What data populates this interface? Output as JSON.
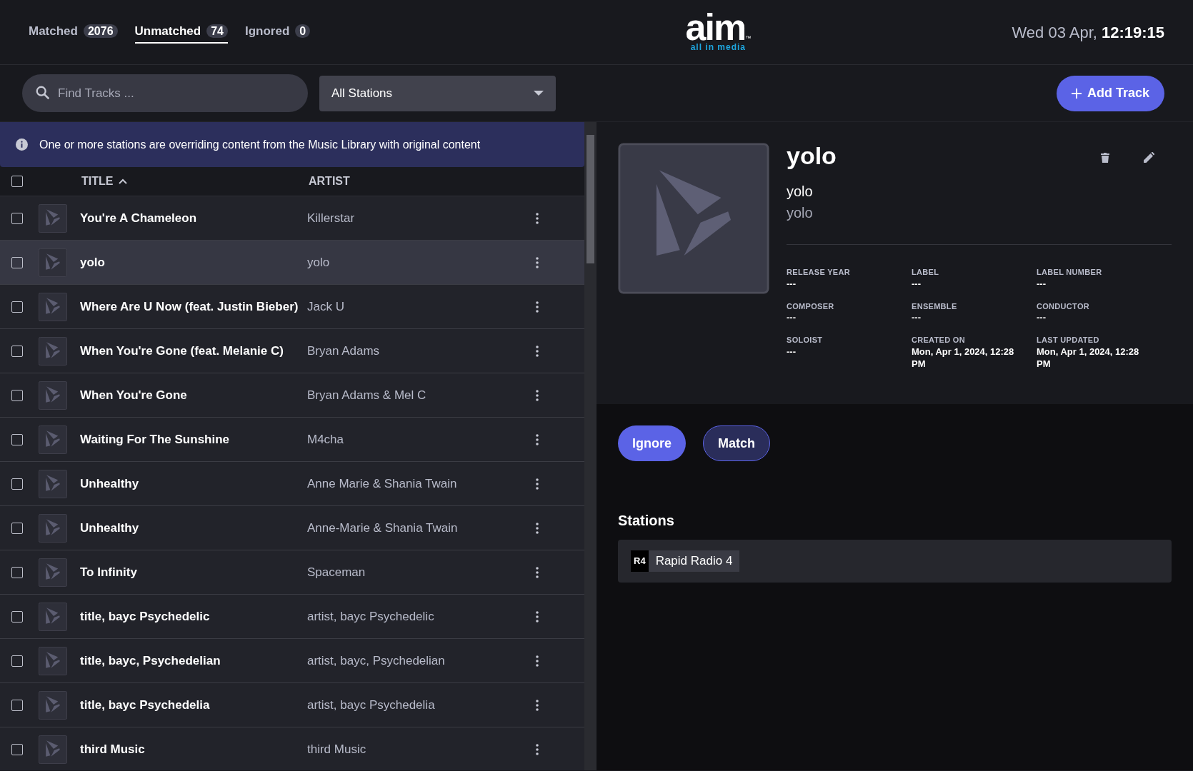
{
  "tabs": [
    {
      "label": "Matched",
      "count": "2076",
      "selected": false
    },
    {
      "label": "Unmatched",
      "count": "74",
      "selected": true
    },
    {
      "label": "Ignored",
      "count": "0",
      "selected": false
    }
  ],
  "logo": {
    "mark": "aim",
    "tm": "™",
    "tagline": "all in media"
  },
  "clock": {
    "date": "Wed 03 Apr,",
    "time": "12:19:15"
  },
  "search": {
    "placeholder": "Find Tracks ..."
  },
  "station_filter": {
    "value": "All Stations"
  },
  "add_button": "Add Track",
  "notice": "One or more stations are overriding content from the Music Library with original content",
  "table": {
    "select_all_checked": false,
    "columns": [
      {
        "label": "TITLE",
        "sorted": true
      },
      {
        "label": "ARTIST",
        "sorted": false
      }
    ],
    "rows": [
      {
        "title": "You're A Chameleon",
        "artist": "Killerstar",
        "checked": false,
        "selected": false
      },
      {
        "title": "yolo",
        "artist": "yolo",
        "checked": false,
        "selected": true
      },
      {
        "title": "Where Are U Now (feat. Justin Bieber)",
        "artist": "Jack U",
        "checked": false,
        "selected": false
      },
      {
        "title": "When You're Gone (feat. Melanie C)",
        "artist": "Bryan Adams",
        "checked": false,
        "selected": false
      },
      {
        "title": "When You're Gone",
        "artist": "Bryan Adams & Mel C",
        "checked": false,
        "selected": false
      },
      {
        "title": "Waiting For The Sunshine",
        "artist": "M4cha",
        "checked": false,
        "selected": false
      },
      {
        "title": "Unhealthy",
        "artist": "Anne Marie & Shania Twain",
        "checked": false,
        "selected": false
      },
      {
        "title": "Unhealthy",
        "artist": "Anne-Marie & Shania Twain",
        "checked": false,
        "selected": false
      },
      {
        "title": "To Infinity",
        "artist": "Spaceman",
        "checked": false,
        "selected": false
      },
      {
        "title": "title, bayc Psychedelic",
        "artist": "artist, bayc Psychedelic",
        "checked": false,
        "selected": false
      },
      {
        "title": "title, bayc, Psychedelian",
        "artist": "artist, bayc, Psychedelian",
        "checked": false,
        "selected": false
      },
      {
        "title": "title, bayc Psychedelia",
        "artist": "artist, bayc Psychedelia",
        "checked": false,
        "selected": false
      },
      {
        "title": "third Music",
        "artist": "third Music",
        "checked": false,
        "selected": false
      }
    ]
  },
  "detail": {
    "title": "yolo",
    "subtitle": "yolo",
    "artist": "yolo",
    "fields": [
      {
        "label": "RELEASE YEAR",
        "value": "---"
      },
      {
        "label": "LABEL",
        "value": "---"
      },
      {
        "label": "LABEL NUMBER",
        "value": "---"
      },
      {
        "label": "COMPOSER",
        "value": "---"
      },
      {
        "label": "ENSEMBLE",
        "value": "---"
      },
      {
        "label": "CONDUCTOR",
        "value": "---"
      },
      {
        "label": "SOLOIST",
        "value": "---"
      },
      {
        "label": "CREATED ON",
        "value": "Mon, Apr 1, 2024, 12:28 PM"
      },
      {
        "label": "LAST UPDATED",
        "value": "Mon, Apr 1, 2024, 12:28 PM"
      }
    ],
    "actions": [
      {
        "label": "Ignore",
        "kind": "primary"
      },
      {
        "label": "Match",
        "kind": "outline"
      }
    ],
    "stations_heading": "Stations",
    "stations": [
      {
        "code": "R4",
        "name": "Rapid Radio 4"
      }
    ]
  }
}
